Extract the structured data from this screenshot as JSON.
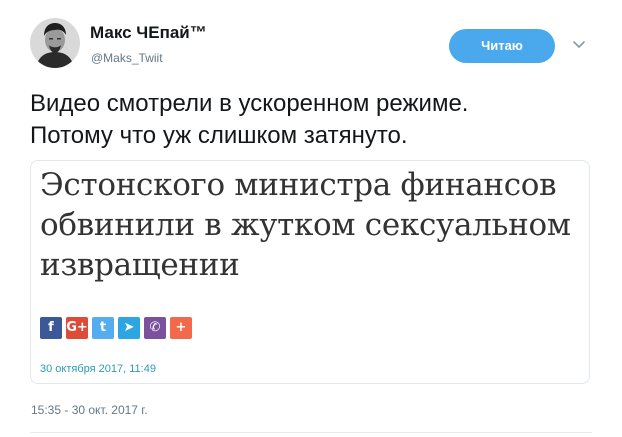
{
  "author": {
    "display_name": "Макс ЧЕпай™",
    "handle": "@Maks_Twiit"
  },
  "follow_button": {
    "label": "Читаю",
    "color": "#4aa8ec"
  },
  "tweet": {
    "text_lines": [
      "Видео смотрели в ускоренном режиме.",
      "Потому что уж слишком затянуто."
    ],
    "timestamp": "15:35 - 30 окт. 2017 г."
  },
  "media": {
    "headline_lines": [
      "Эстонского министра финансов",
      "обвинили в жутком сексуальном",
      "извращении"
    ],
    "share_buttons": [
      {
        "icon": "facebook-icon",
        "glyph": "f",
        "color": "#3b5998"
      },
      {
        "icon": "google-plus-icon",
        "glyph": "G+",
        "color": "#dd4b39"
      },
      {
        "icon": "twitter-icon",
        "glyph": "t",
        "color": "#55acee"
      },
      {
        "icon": "telegram-icon",
        "glyph": "➤",
        "color": "#2ca5e0"
      },
      {
        "icon": "viber-icon",
        "glyph": "✆",
        "color": "#7b519d"
      },
      {
        "icon": "more-share-icon",
        "glyph": "+",
        "color": "#f26a4b"
      }
    ],
    "date": "30 октября 2017, 11:49"
  },
  "icons": {
    "options_menu": "chevron-down-icon",
    "avatar": "avatar-photo"
  }
}
